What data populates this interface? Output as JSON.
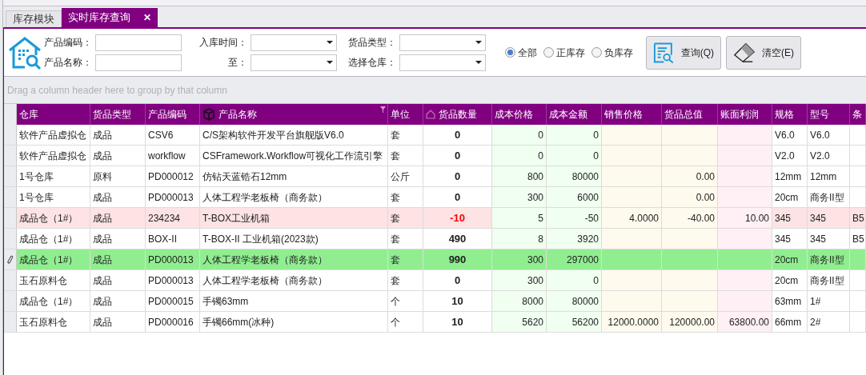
{
  "tabs": [
    {
      "label": "库存模块",
      "selected": false
    },
    {
      "label": "实时库存查询",
      "selected": true,
      "close": "✕"
    }
  ],
  "filters": {
    "left": [
      {
        "label": "产品编码：",
        "kind": "input"
      },
      {
        "label": "产品名称：",
        "kind": "input"
      }
    ],
    "middle": [
      {
        "label": "入库时间：",
        "kind": "dropdown"
      },
      {
        "label": "至：",
        "kind": "dropdown"
      }
    ],
    "right": [
      {
        "label": "货品类型：",
        "kind": "dropdown"
      },
      {
        "label": "选择仓库：",
        "kind": "dropdown"
      }
    ]
  },
  "stock_options": [
    {
      "label": "全部",
      "selected": true
    },
    {
      "label": "正库存",
      "selected": false
    },
    {
      "label": "负库存",
      "selected": false
    }
  ],
  "buttons": [
    {
      "label": "查询(Q)",
      "kind": "search"
    },
    {
      "label": "清空(E)",
      "kind": "clear"
    }
  ],
  "group_panel": {
    "hint": "Drag a column header here to group by that column"
  },
  "table": {
    "columns": [
      "仓库",
      "货品类型",
      "产品编码",
      "产品名称",
      "单位",
      "货品数量",
      "成本价格",
      "成本金额",
      "销售价格",
      "货品总值",
      "账面利润",
      "规格",
      "型号",
      "条"
    ],
    "rows": [
      {
        "selected": false,
        "negative": false,
        "cells": [
          "软件产品虚拟仓",
          "成品",
          "CSV6",
          "C/S架构软件开发平台旗舰版V6.0",
          "套",
          "0",
          "0",
          "0",
          "",
          "",
          "",
          "V6.0",
          "V6.0",
          ""
        ]
      },
      {
        "selected": false,
        "negative": false,
        "cells": [
          "软件产品虚拟仓",
          "成品",
          "workflow",
          "CSFramework.Workflow可视化工作流引擎",
          "套",
          "0",
          "0",
          "0",
          "",
          "",
          "",
          "V2.0",
          "V2.0",
          ""
        ]
      },
      {
        "selected": false,
        "negative": false,
        "cells": [
          "1号仓库",
          "原料",
          "PD000012",
          "仿钻天蓝锆石12mm",
          "公斤",
          "0",
          "800",
          "80000",
          "",
          "0.00",
          "",
          "12mm",
          "12mm",
          ""
        ]
      },
      {
        "selected": false,
        "negative": false,
        "cells": [
          "1号仓库",
          "成品",
          "PD000013",
          "人体工程学老板椅（商务款）",
          "套",
          "0",
          "300",
          "6000",
          "",
          "0.00",
          "",
          "20cm",
          "商务II型",
          ""
        ]
      },
      {
        "selected": false,
        "negative": true,
        "cells": [
          "成品仓（1#）",
          "成品",
          "234234",
          "T-BOX工业机箱",
          "套",
          "-10",
          "5",
          "-50",
          "4.0000",
          "-40.00",
          "10.00",
          "345",
          "345",
          "B5"
        ]
      },
      {
        "selected": false,
        "negative": false,
        "cells": [
          "成品仓（1#）",
          "成品",
          "BOX-II",
          "T-BOX-II 工业机箱(2023款)",
          "套",
          "490",
          "8",
          "3920",
          "",
          "",
          "",
          "345",
          "345",
          "B5"
        ]
      },
      {
        "selected": true,
        "negative": false,
        "cells": [
          "成品仓（1#）",
          "成品",
          "PD000013",
          "人体工程学老板椅（商务款）",
          "套",
          "990",
          "300",
          "297000",
          "",
          "",
          "",
          "20cm",
          "商务II型",
          ""
        ]
      },
      {
        "selected": false,
        "negative": false,
        "cells": [
          "玉石原料仓",
          "成品",
          "PD000013",
          "人体工程学老板椅（商务款）",
          "套",
          "0",
          "300",
          "0",
          "",
          "",
          "",
          "20cm",
          "商务II型",
          ""
        ]
      },
      {
        "selected": false,
        "negative": false,
        "cells": [
          "成品仓（1#）",
          "成品",
          "PD000015",
          "手镯63mm",
          "个",
          "10",
          "8000",
          "80000",
          "",
          "",
          "",
          "63mm",
          "1#",
          ""
        ]
      },
      {
        "selected": false,
        "negative": false,
        "cells": [
          "玉石原料仓",
          "成品",
          "PD000016",
          "手镯66mm(冰种)",
          "个",
          "10",
          "5620",
          "56200",
          "12000.0000",
          "120000.00",
          "63800.00",
          "66mm",
          "2#",
          ""
        ]
      }
    ]
  }
}
